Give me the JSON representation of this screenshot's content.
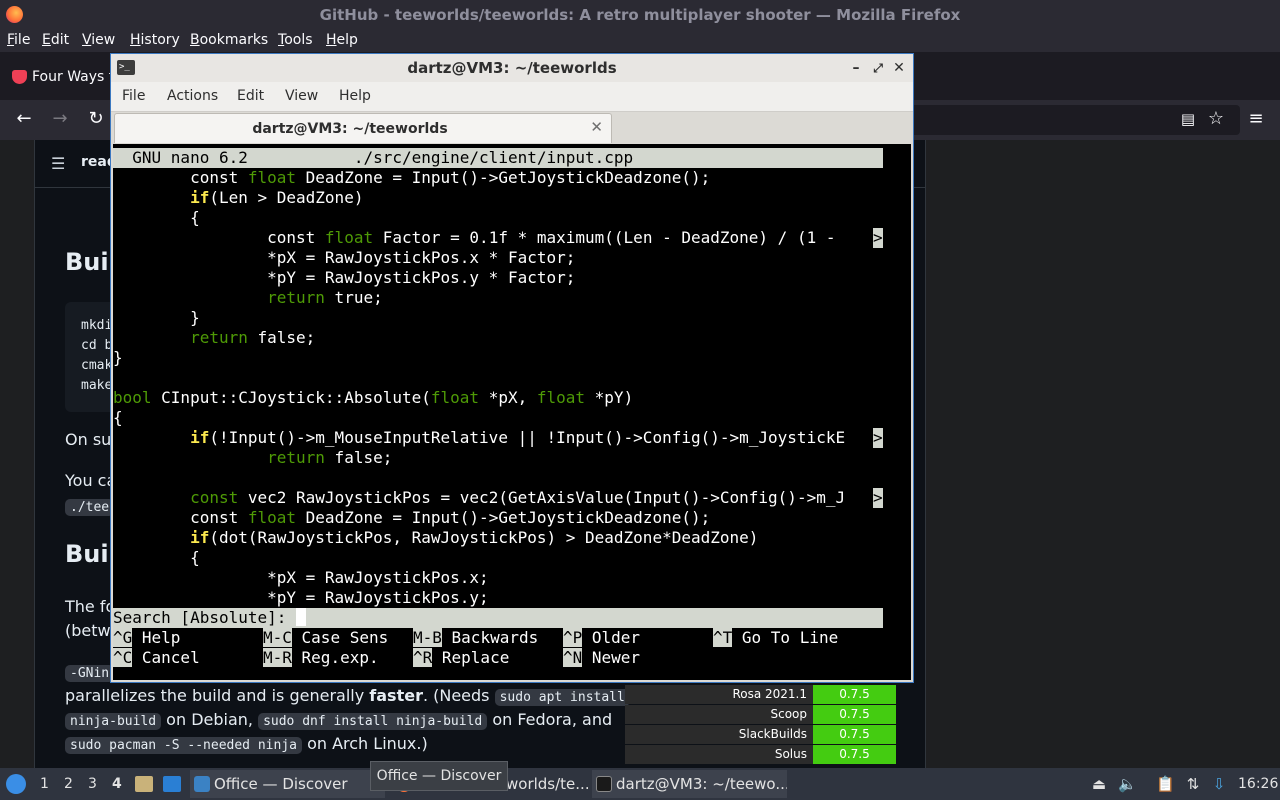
{
  "firefox": {
    "window_title": "GitHub - teeworlds/teeworlds: A retro multiplayer shooter — Mozilla Firefox",
    "menu": [
      "File",
      "Edit",
      "View",
      "History",
      "Bookmarks",
      "Tools",
      "Help"
    ],
    "bookmark_tab": "Four Ways t",
    "readme_label": "read",
    "headings": [
      "Buil",
      "Buil"
    ],
    "code_lines": [
      "mkdi",
      "cd b",
      "cmak",
      "make"
    ],
    "paragraphs": [
      "On sul",
      "You ca",
      "./tee",
      "The fo",
      "(betwe",
      "-GNin"
    ],
    "para_build": {
      "t1": "parallelizes the build and is generally ",
      "bold": "faster",
      "t2": ". (Needs ",
      "k1": "sudo apt install",
      "k2": "ninja-build",
      "t3": " on Debian, ",
      "k3": "sudo dnf install ninja-build",
      "t4": " on Fedora, and",
      "k4": "sudo pacman -S --needed ninja",
      "t5": " on Arch Linux.)"
    },
    "packages": [
      {
        "name": "Rosa 2021.1",
        "version": "0.7.5"
      },
      {
        "name": "Scoop",
        "version": "0.7.5"
      },
      {
        "name": "SlackBuilds",
        "version": "0.7.5"
      },
      {
        "name": "Solus",
        "version": "0.7.5"
      }
    ]
  },
  "terminal": {
    "title": "dartz@VM3: ~/teeworlds",
    "menu": [
      "File",
      "Actions",
      "Edit",
      "View",
      "Help"
    ],
    "tab_title": "dartz@VM3: ~/teeworlds",
    "nano_header": "  GNU nano 6.2           ./src/engine/client/input.cpp",
    "code": {
      "l1a": "        const ",
      "l1b": "float",
      "l1c": " DeadZone = Input()->GetJoystickDeadzone();",
      "l2a": "        ",
      "l2b": "if",
      "l2c": "(Len > DeadZone)",
      "l3": "        {",
      "l4a": "                const ",
      "l4b": "float",
      "l4c": " Factor = 0.1f * maximum((Len - DeadZone) / (1 - ",
      "l5": "                *pX = RawJoystickPos.x * Factor;",
      "l6": "                *pY = RawJoystickPos.y * Factor;",
      "l7a": "                ",
      "l7b": "return",
      "l7c": " true;",
      "l8": "        }",
      "l9a": "        ",
      "l9b": "return",
      "l9c": " false;",
      "l10": "}",
      "l12a": "bool",
      "l12b": " CInput::CJoystick::Absolute(",
      "l12c": "float",
      "l12d": " *pX, ",
      "l12e": "float",
      "l12f": " *pY)",
      "l13": "{",
      "l14a": "        ",
      "l14b": "if",
      "l14c": "(!Input()->m_MouseInputRelative || !Input()->Config()->m_JoystickE",
      "l15a": "                ",
      "l15b": "return",
      "l15c": " false;",
      "l17a": "        const",
      "l17b": " vec2 RawJoystickPos = vec2(GetAxisValue(Input()->Config()->m_J",
      "l18a": "        const ",
      "l18b": "float",
      "l18c": " DeadZone = Input()->GetJoystickDeadzone();",
      "l19a": "        ",
      "l19b": "if",
      "l19c": "(dot(RawJoystickPos, RawJoystickPos) > DeadZone*DeadZone)",
      "l20": "        {",
      "l21": "                *pX = RawJoystickPos.x;",
      "l22": "                *pY = RawJoystickPos.y;"
    },
    "truncation_marker": ">",
    "search_prompt": "Search [Absolute]: ",
    "shortcuts": [
      {
        "key": "^G",
        "label": " Help"
      },
      {
        "key": "M-C",
        "label": " Case Sens"
      },
      {
        "key": "M-B",
        "label": " Backwards"
      },
      {
        "key": "^P",
        "label": " Older"
      },
      {
        "key": "^T",
        "label": " Go To Line"
      },
      {
        "key": "^C",
        "label": " Cancel"
      },
      {
        "key": "M-R",
        "label": " Reg.exp."
      },
      {
        "key": "^R",
        "label": " Replace"
      },
      {
        "key": "^N",
        "label": " Newer"
      }
    ]
  },
  "taskbar": {
    "workspaces": [
      "1",
      "2",
      "3",
      "4"
    ],
    "tasks": [
      "Office — Discover",
      "worlds/te...",
      "dartz@VM3: ~/teewo..."
    ],
    "tooltip": "Office — Discover",
    "clock": "16:26"
  },
  "colors": {
    "nano_green": "#4e9a06",
    "nano_yellow": "#fce94f",
    "terminal_border": "#3b78c0"
  }
}
